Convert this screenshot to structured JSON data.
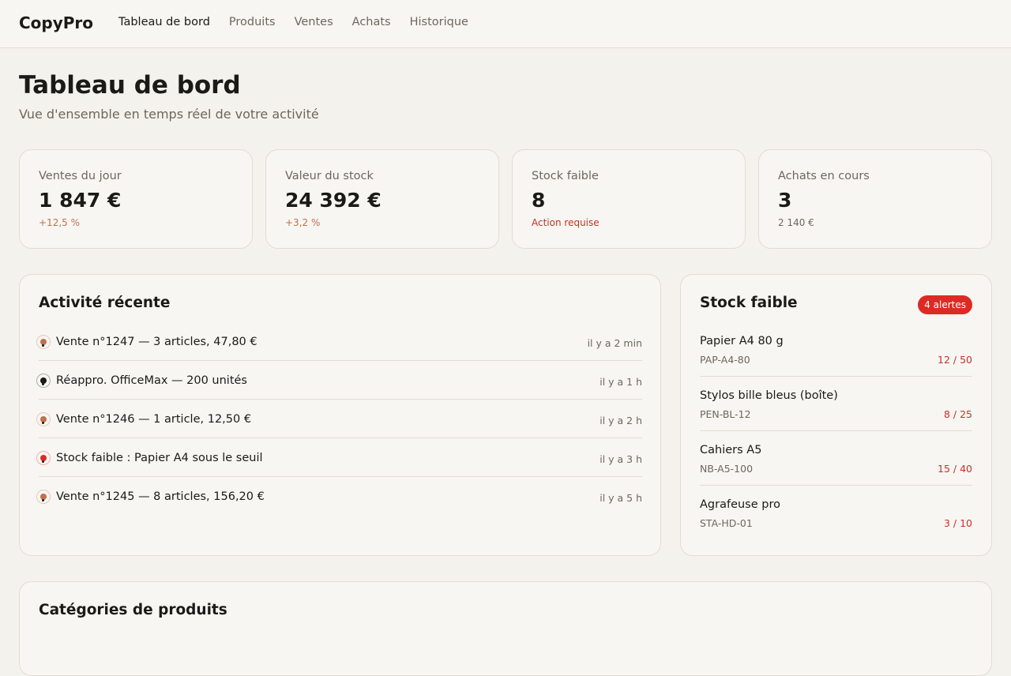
{
  "brand": "CopyPro",
  "nav": [
    {
      "label": "Tableau de bord",
      "active": true
    },
    {
      "label": "Produits"
    },
    {
      "label": "Ventes"
    },
    {
      "label": "Achats"
    },
    {
      "label": "Historique"
    }
  ],
  "page": {
    "title": "Tableau de bord",
    "subtitle": "Vue d'ensemble en temps réel de votre activité"
  },
  "stats": [
    {
      "label": "Ventes du jour",
      "value": "1 847 €",
      "note": "+12,5 %",
      "note_color": "#c0714a"
    },
    {
      "label": "Valeur du stock",
      "value": "24 392 €",
      "note": "+3,2 %",
      "note_color": "#c0714a"
    },
    {
      "label": "Stock faible",
      "value": "8",
      "note": "Action requise",
      "note_color": "#c8302a"
    },
    {
      "label": "Achats en cours",
      "value": "3",
      "note": "2 140 €",
      "note_color": "#6d675e"
    }
  ],
  "activity": {
    "title": "Activité récente",
    "items": [
      {
        "text": "Vente n°1247 — 3 articles, 47,80 €",
        "time": "il y a 2 min",
        "icon": "sale-pin-icon",
        "color": "#c0714a"
      },
      {
        "text": "Réappro. OfficeMax — 200 unités",
        "time": "il y a 1 h",
        "icon": "restock-pin-icon",
        "color": "#1c1a17"
      },
      {
        "text": "Vente n°1246 — 1 article, 12,50 €",
        "time": "il y a 2 h",
        "icon": "sale-pin-icon",
        "color": "#c0714a"
      },
      {
        "text": "Stock faible : Papier A4 sous le seuil",
        "time": "il y a 3 h",
        "icon": "alert-pin-icon",
        "color": "#dc2b24"
      },
      {
        "text": "Vente n°1245 — 8 articles, 156,20 €",
        "time": "il y a 5 h",
        "icon": "sale-pin-icon",
        "color": "#c0714a"
      }
    ]
  },
  "low_stock": {
    "title": "Stock faible",
    "badge": "4 alertes",
    "items": [
      {
        "name": "Papier A4 80 g",
        "sku": "PAP-A4-80",
        "qty": "12 / 50"
      },
      {
        "name": "Stylos bille bleus (boîte)",
        "sku": "PEN-BL-12",
        "qty": "8 / 25"
      },
      {
        "name": "Cahiers A5",
        "sku": "NB-A5-100",
        "qty": "15 / 40"
      },
      {
        "name": "Agrafeuse pro",
        "sku": "STA-HD-01",
        "qty": "3 / 10"
      }
    ]
  },
  "categories": {
    "title": "Catégories de produits"
  }
}
